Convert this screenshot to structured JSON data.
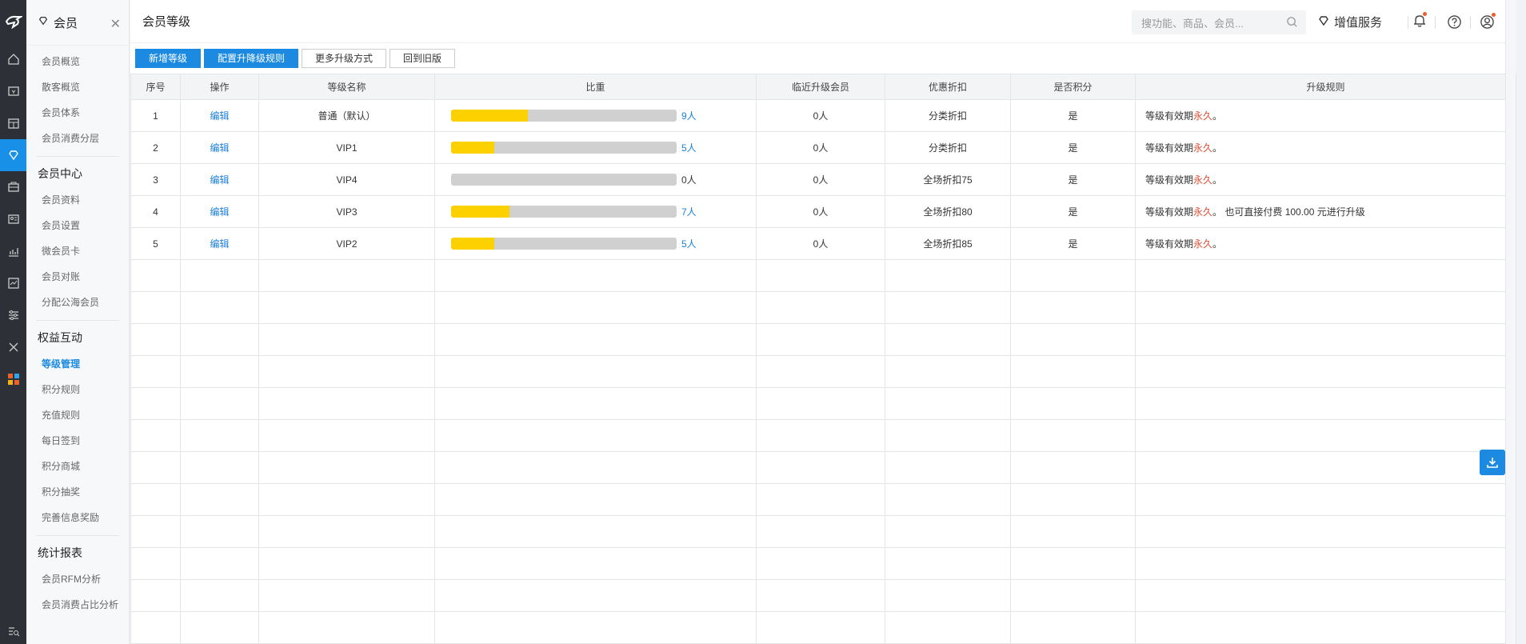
{
  "colors": {
    "accent": "#1b8ae0",
    "rail": "#2d3036",
    "bar_fill": "#fdd000",
    "bar_bg": "#d0d0d0",
    "highlight_red": "#e54c2c"
  },
  "rail_icons": [
    "home-icon",
    "cashier-icon",
    "shop-icon",
    "member-icon",
    "marketing-icon",
    "staff-icon",
    "report-icon",
    "data-icon",
    "settings-icon",
    "tools-icon",
    "apps-icon"
  ],
  "submenu": {
    "title": "会员",
    "groups": [
      {
        "title": "",
        "items": [
          "会员概览",
          "散客概览",
          "会员体系",
          "会员消费分层"
        ]
      },
      {
        "title": "会员中心",
        "items": [
          "会员资料",
          "会员设置",
          "微会员卡",
          "会员对账",
          "分配公海会员"
        ]
      },
      {
        "title": "权益互动",
        "items": [
          "等级管理",
          "积分规则",
          "充值规则",
          "每日签到",
          "积分商城",
          "积分抽奖",
          "完善信息奖励"
        ]
      },
      {
        "title": "统计报表",
        "items": [
          "会员RFM分析",
          "会员消费占比分析"
        ]
      }
    ],
    "active": "等级管理"
  },
  "header": {
    "title": "会员等级",
    "search_placeholder": "搜功能、商品、会员...",
    "value_added": "增值服务"
  },
  "toolbar": {
    "add_level": "新增等级",
    "config_rules": "配置升降级规则",
    "more_methods": "更多升级方式",
    "back_old": "回到旧版"
  },
  "table": {
    "columns": [
      "序号",
      "操作",
      "等级名称",
      "比重",
      "临近升级会员",
      "优惠折扣",
      "是否积分",
      "升级规则"
    ],
    "rows": [
      {
        "idx": "1",
        "op": "编辑",
        "name": "普通（默认）",
        "ratio": 0.34,
        "count": "9人",
        "near": "0人",
        "discount": "分类折扣",
        "points": "是",
        "rule_pre": "等级有效期",
        "rule_red": "永久",
        "rule_post": "。"
      },
      {
        "idx": "2",
        "op": "编辑",
        "name": "VIP1",
        "ratio": 0.19,
        "count": "5人",
        "near": "0人",
        "discount": "分类折扣",
        "points": "是",
        "rule_pre": "等级有效期",
        "rule_red": "永久",
        "rule_post": "。"
      },
      {
        "idx": "3",
        "op": "编辑",
        "name": "VIP4",
        "ratio": 0.0,
        "count": "0人",
        "near": "0人",
        "discount": "全场折扣75",
        "points": "是",
        "rule_pre": "等级有效期",
        "rule_red": "永久",
        "rule_post": "。"
      },
      {
        "idx": "4",
        "op": "编辑",
        "name": "VIP3",
        "ratio": 0.26,
        "count": "7人",
        "near": "0人",
        "discount": "全场折扣80",
        "points": "是",
        "rule_pre": "等级有效期",
        "rule_red": "永久",
        "rule_post": "。 也可直接付费 100.00 元进行升级"
      },
      {
        "idx": "5",
        "op": "编辑",
        "name": "VIP2",
        "ratio": 0.19,
        "count": "5人",
        "near": "0人",
        "discount": "全场折扣85",
        "points": "是",
        "rule_pre": "等级有效期",
        "rule_red": "永久",
        "rule_post": "。"
      }
    ]
  }
}
